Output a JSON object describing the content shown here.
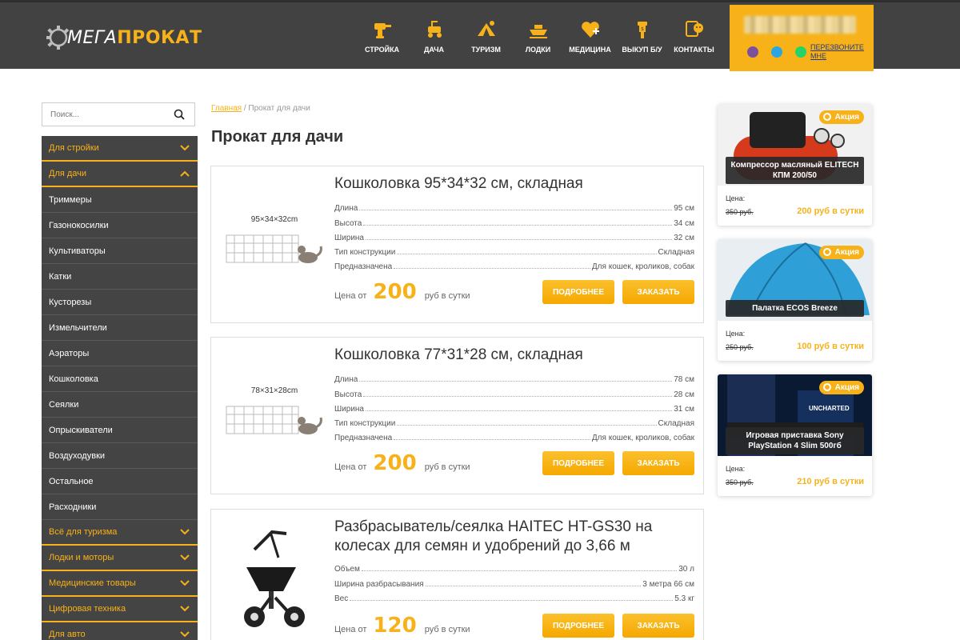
{
  "header": {
    "logo_mega": "МЕГА",
    "logo_prokat": "ПРОКАТ",
    "nav": [
      {
        "label": "СТРОЙКА",
        "icon": "drill-icon"
      },
      {
        "label": "ДАЧА",
        "icon": "lawnmower-icon"
      },
      {
        "label": "ТУРИЗМ",
        "icon": "tent-icon"
      },
      {
        "label": "ЛОДКИ",
        "icon": "boat-icon"
      },
      {
        "label": "МЕДИЦИНА",
        "icon": "heart-plus-icon"
      },
      {
        "label": "ВЫКУП Б/У",
        "icon": "buyback-icon"
      },
      {
        "label": "КОНТАКТЫ",
        "icon": "chat-icon"
      }
    ],
    "callback_label": "ПЕРЕЗВОНИТЕ МНЕ",
    "accent": "#f7b21a"
  },
  "search": {
    "placeholder": "Поиск..."
  },
  "sidebar": {
    "items": [
      {
        "label": "Для стройки",
        "type": "cat",
        "chevron": "down"
      },
      {
        "label": "Для дачи",
        "type": "cat",
        "chevron": "up"
      },
      {
        "label": "Триммеры",
        "type": "sub"
      },
      {
        "label": "Газонокосилки",
        "type": "sub"
      },
      {
        "label": "Культиваторы",
        "type": "sub"
      },
      {
        "label": "Катки",
        "type": "sub"
      },
      {
        "label": "Кусторезы",
        "type": "sub"
      },
      {
        "label": "Измельчители",
        "type": "sub"
      },
      {
        "label": "Аэраторы",
        "type": "sub"
      },
      {
        "label": "Кошколовка",
        "type": "sub"
      },
      {
        "label": "Сеялки",
        "type": "sub"
      },
      {
        "label": "Опрыскиватели",
        "type": "sub"
      },
      {
        "label": "Воздуходувки",
        "type": "sub"
      },
      {
        "label": "Остальное",
        "type": "sub"
      },
      {
        "label": "Расходники",
        "type": "sub"
      },
      {
        "label": "Всё для туризма",
        "type": "cat",
        "chevron": "down"
      },
      {
        "label": "Лодки и моторы",
        "type": "cat",
        "chevron": "down"
      },
      {
        "label": "Медицинские товары",
        "type": "cat",
        "chevron": "down"
      },
      {
        "label": "Цифровая техника",
        "type": "cat",
        "chevron": "down"
      },
      {
        "label": "Для авто",
        "type": "cat",
        "chevron": "down"
      }
    ]
  },
  "breadcrumb": {
    "home": "Главная",
    "sep": " / ",
    "current": "Прокат для дачи"
  },
  "page_title": "Прокат для дачи",
  "products": [
    {
      "title": "Кошколовка 95*34*32 см, складная",
      "dim_label": "95×34×32cm",
      "specs": [
        {
          "k": "Длина",
          "v": "95 см"
        },
        {
          "k": "Высота",
          "v": "34 см"
        },
        {
          "k": "Ширина",
          "v": "32 см"
        },
        {
          "k": "Тип конструкции",
          "v": "Складная"
        },
        {
          "k": "Предназначена",
          "v": "Для кошек, кроликов, собак"
        }
      ],
      "price_pre": "Цена от",
      "price": "200",
      "price_post": "руб в сутки",
      "btn_more": "ПОДРОБНЕЕ",
      "btn_order": "ЗАКАЗАТЬ"
    },
    {
      "title": "Кошколовка 77*31*28 см, складная",
      "dim_label": "78×31×28cm",
      "specs": [
        {
          "k": "Длина",
          "v": "78 см"
        },
        {
          "k": "Высота",
          "v": "28 см"
        },
        {
          "k": "Ширина",
          "v": "31 см"
        },
        {
          "k": "Тип конструкции",
          "v": "Складная"
        },
        {
          "k": "Предназначена",
          "v": "Для кошек, кроликов, собак"
        }
      ],
      "price_pre": "Цена от",
      "price": "200",
      "price_post": "руб в сутки",
      "btn_more": "ПОДРОБНЕЕ",
      "btn_order": "ЗАКАЗАТЬ"
    },
    {
      "title": "Разбрасыватель/сеялка HAITEC HT-GS30 на колесах для семян и удобрений до 3,66 м",
      "dim_label": "",
      "specs": [
        {
          "k": "Объем",
          "v": "30 л"
        },
        {
          "k": "Ширина разбрасывания",
          "v": "3 метра 66 см"
        },
        {
          "k": "Вес",
          "v": "5.3 кг"
        }
      ],
      "price_pre": "Цена от",
      "price": "120",
      "price_post": "руб в сутки",
      "btn_more": "ПОДРОБНЕЕ",
      "btn_order": "ЗАКАЗАТЬ"
    }
  ],
  "promos": [
    {
      "badge": "Акция",
      "name": "Компрессор масляный ELITECH КПМ 200/50",
      "price_label": "Цена:",
      "old": "350 руб.",
      "new": "200 руб в сутки"
    },
    {
      "badge": "Акция",
      "name": "Палатка ECOS Breeze",
      "price_label": "Цена:",
      "old": "250 руб.",
      "new": "100 руб в сутки"
    },
    {
      "badge": "Акция",
      "name": "Игровая приставка Sony PlayStation 4 Slim 500гб",
      "price_label": "Цена:",
      "old": "350 руб.",
      "new": "210 руб в сутки",
      "img_text": "UNCHARTED"
    }
  ]
}
